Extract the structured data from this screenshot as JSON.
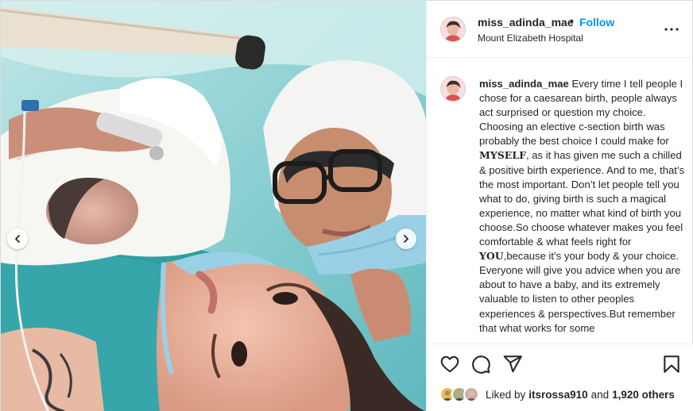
{
  "post": {
    "username": "miss_adinda_mae",
    "separator": "•",
    "follow_label": "Follow",
    "location": "Mount Elizabeth Hospital",
    "more_icon": "more-horizontal-icon"
  },
  "caption": {
    "username": "miss_adinda_mae",
    "part1": " Every time I tell people I chose for a caesarean birth, people always act surprised or question my choice. Choosing an elective c-section birth was probably the best choice I could make for ",
    "emphasis1": "MYSELF",
    "part2": ", as it has given me such a chilled & positive birth experience. And to me, that’s the most important. Don’t let people tell you what to do, giving birth is such a magical experience, no matter what kind of birth you choose.So choose whatever makes you feel comfortable & what feels right for ",
    "emphasis2": "YOU",
    "part3": ",because it’s your body & your choice. Everyone will give you advice when you are about to have a baby, and its extremely valuable to listen to other peoples experiences & perspectives.But remember that what works for some"
  },
  "actions": {
    "like_icon": "heart-icon",
    "comment_icon": "comment-icon",
    "share_icon": "send-icon",
    "save_icon": "bookmark-icon"
  },
  "likes": {
    "prefix": "Liked by",
    "liker": "itsrossa910",
    "and": "and",
    "others": "1,920 others"
  },
  "carousel": {
    "prev_icon": "chevron-left-icon",
    "next_icon": "chevron-right-icon"
  },
  "colors": {
    "link_blue": "#0095f6",
    "text": "#262626",
    "border": "#dbdbdb"
  }
}
